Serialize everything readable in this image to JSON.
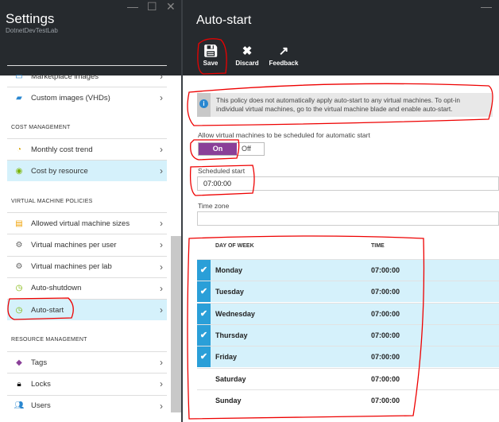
{
  "left_blade": {
    "title": "Settings",
    "subtitle": "DotnetDevTestLab",
    "items_top": [
      {
        "label": "Marketplace images",
        "icon": "marketplace-icon"
      },
      {
        "label": "Custom images (VHDs)",
        "icon": "custom-image-icon"
      }
    ],
    "sections": [
      {
        "header": "COST MANAGEMENT",
        "items": [
          {
            "label": "Monthly cost trend",
            "icon": "chart-icon"
          },
          {
            "label": "Cost by resource",
            "icon": "cost-icon",
            "selected": true
          }
        ]
      },
      {
        "header": "VIRTUAL MACHINE POLICIES",
        "items": [
          {
            "label": "Allowed virtual machine sizes",
            "icon": "sizes-icon"
          },
          {
            "label": "Virtual machines per user",
            "icon": "gear-icon"
          },
          {
            "label": "Virtual machines per lab",
            "icon": "gear-icon"
          },
          {
            "label": "Auto-shutdown",
            "icon": "clock-icon"
          },
          {
            "label": "Auto-start",
            "icon": "clock-icon",
            "selected": true
          }
        ]
      },
      {
        "header": "RESOURCE MANAGEMENT",
        "items": [
          {
            "label": "Tags",
            "icon": "tag-icon"
          },
          {
            "label": "Locks",
            "icon": "lock-icon"
          },
          {
            "label": "Users",
            "icon": "users-icon"
          }
        ]
      }
    ]
  },
  "blade": {
    "title": "Auto-start",
    "toolbar": {
      "save": "Save",
      "discard": "Discard",
      "feedback": "Feedback"
    },
    "info": "This policy does not automatically apply auto-start to any virtual machines. To opt-in individual virtual machines, go to the virtual machine blade and enable auto-start.",
    "allow_label": "Allow virtual machines to be scheduled for automatic start",
    "toggle": {
      "on": "On",
      "off": "Off",
      "value": "On"
    },
    "scheduled_label": "Scheduled start",
    "scheduled_value": "07:00:00",
    "timezone_label": "Time zone",
    "timezone_value": "",
    "table": {
      "headers": [
        "DAY OF WEEK",
        "TIME"
      ],
      "rows": [
        {
          "day": "Monday",
          "time": "07:00:00",
          "checked": true
        },
        {
          "day": "Tuesday",
          "time": "07:00:00",
          "checked": true
        },
        {
          "day": "Wednesday",
          "time": "07:00:00",
          "checked": true
        },
        {
          "day": "Thursday",
          "time": "07:00:00",
          "checked": true
        },
        {
          "day": "Friday",
          "time": "07:00:00",
          "checked": true
        },
        {
          "day": "Saturday",
          "time": "07:00:00",
          "checked": false
        },
        {
          "day": "Sunday",
          "time": "07:00:00",
          "checked": false
        }
      ]
    }
  },
  "colors": {
    "accent": "#8a3f98",
    "selection": "#d5f1fb",
    "check": "#2a9fd8",
    "header": "#262a2e"
  }
}
